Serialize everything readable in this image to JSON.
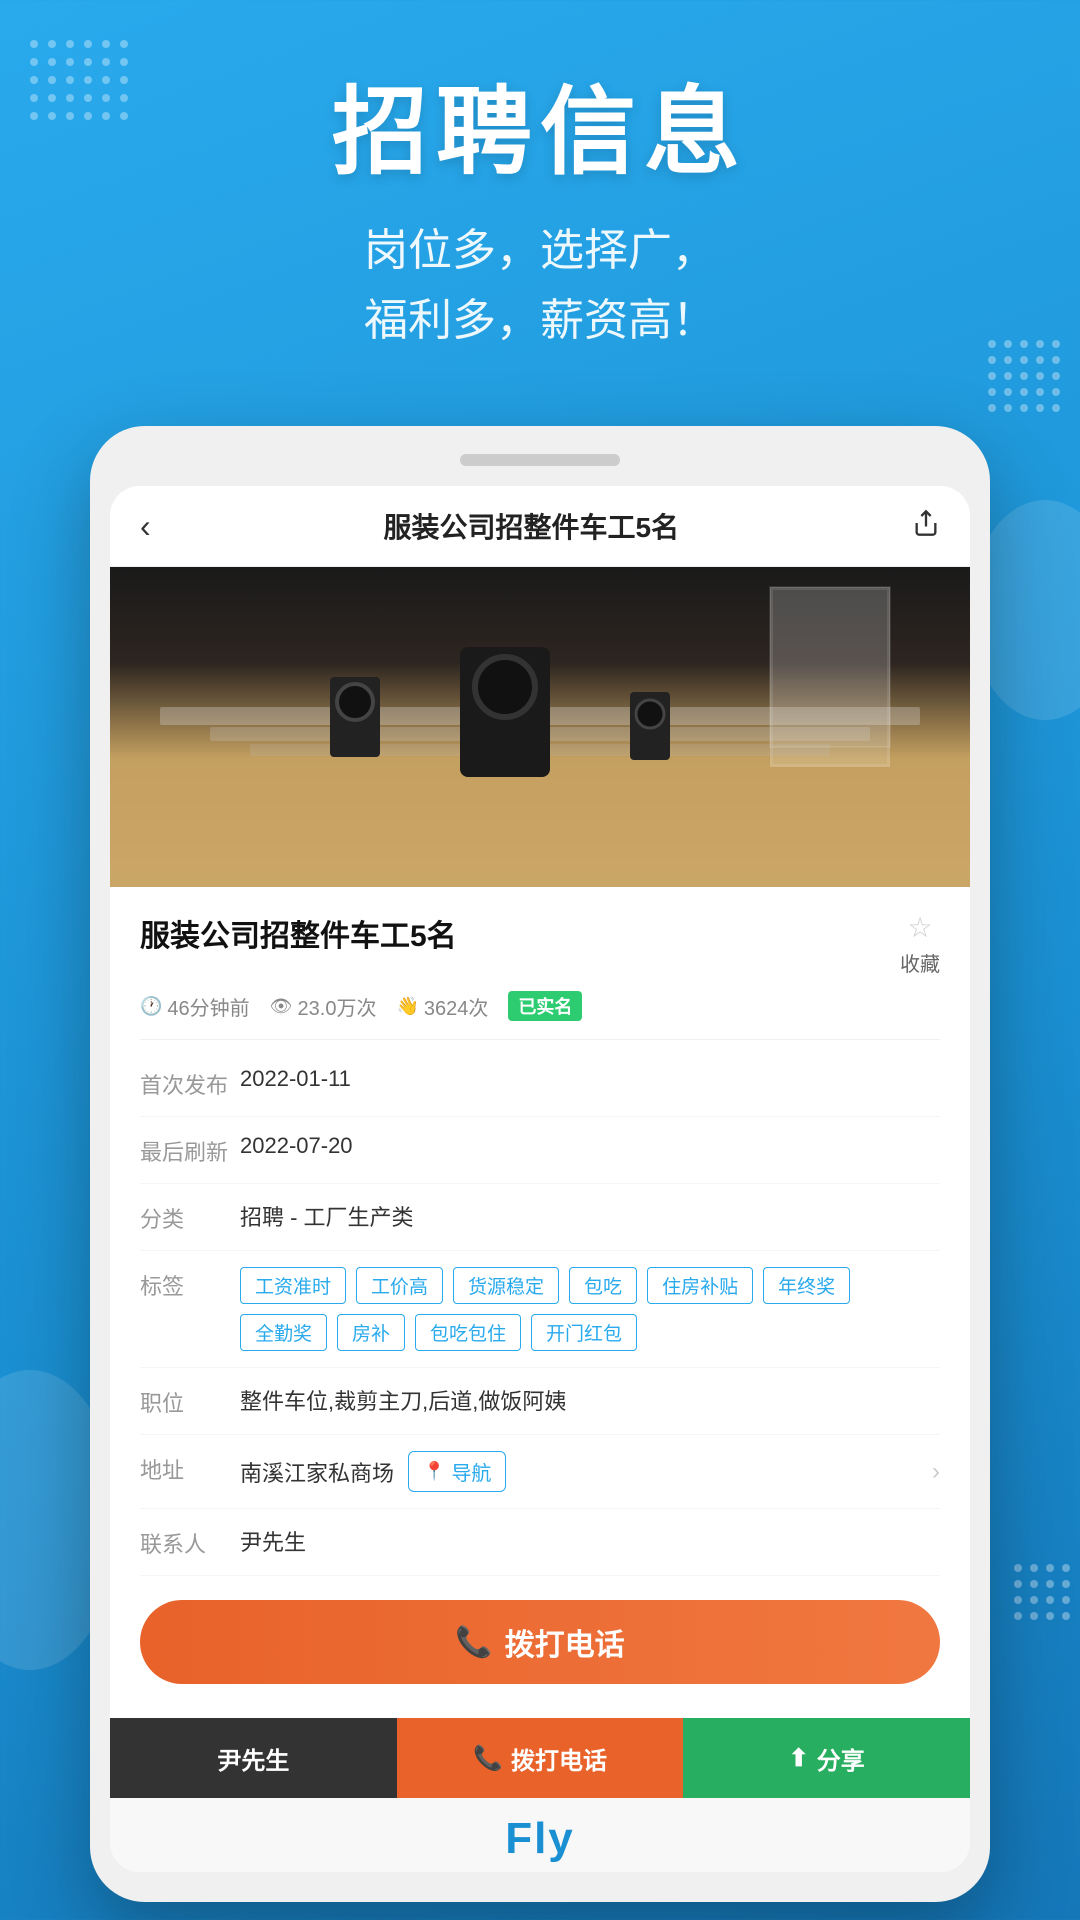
{
  "header": {
    "main_title": "招聘信息",
    "subtitle_line1": "岗位多，选择广，",
    "subtitle_line2": "福利多，薪资高！"
  },
  "phone": {
    "notch_visible": true
  },
  "app": {
    "navbar": {
      "title": "服装公司招整件车工5名",
      "back_label": "‹",
      "share_label": "⬆"
    },
    "job": {
      "title": "服装公司招整件车工5名",
      "bookmark_label": "收藏",
      "meta": {
        "time_ago": "46分钟前",
        "views": "23.0万次",
        "applies": "3624次",
        "verified_badge": "已实名"
      },
      "details": {
        "first_publish_label": "首次发布",
        "first_publish_value": "2022-01-11",
        "last_refresh_label": "最后刷新",
        "last_refresh_value": "2022-07-20",
        "category_label": "分类",
        "category_value": "招聘 - 工厂生产类",
        "tags_label": "标签",
        "tags": [
          "工资准时",
          "工价高",
          "货源稳定",
          "包吃",
          "住房补贴",
          "年终奖",
          "全勤奖",
          "房补",
          "包吃包住",
          "开门红包"
        ],
        "position_label": "职位",
        "position_value": "整件车位,裁剪主刀,后道,做饭阿姨",
        "address_label": "地址",
        "address_value": "南溪江家私商场",
        "nav_btn_label": "导航",
        "contact_label": "联系人",
        "contact_value": "尹先生"
      },
      "call_button_label": "拨打电话"
    },
    "bottom_bar": {
      "user_tab_label": "尹先生",
      "call_tab_label": "拨打电话",
      "share_tab_label": "分享"
    },
    "footer_name": "Fly"
  }
}
